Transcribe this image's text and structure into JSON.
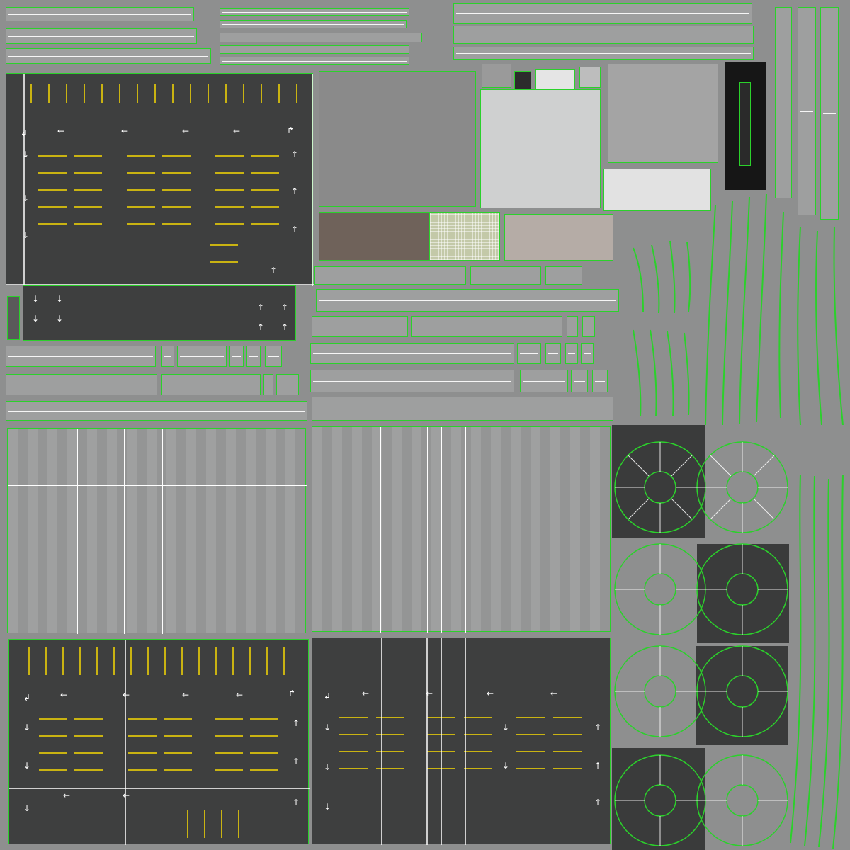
{
  "texture": {
    "kind": "parking-garage-uv-atlas",
    "colors": {
      "background": "#8e8f8f",
      "concrete": "#9a9b9b",
      "asphalt": "#3e3f3f",
      "uv_outline": "#2bd12b",
      "marking_white": "#ffffff",
      "marking_yellow": "#c9b312",
      "roof_gray": "#8a8a8a",
      "brown_panel": "#6f625a",
      "black_panel": "#161616"
    },
    "arrows": {
      "left": "←",
      "right": "→",
      "up": "↑",
      "down": "↓",
      "corner_left_down": "↲",
      "corner_up": "↱"
    }
  }
}
